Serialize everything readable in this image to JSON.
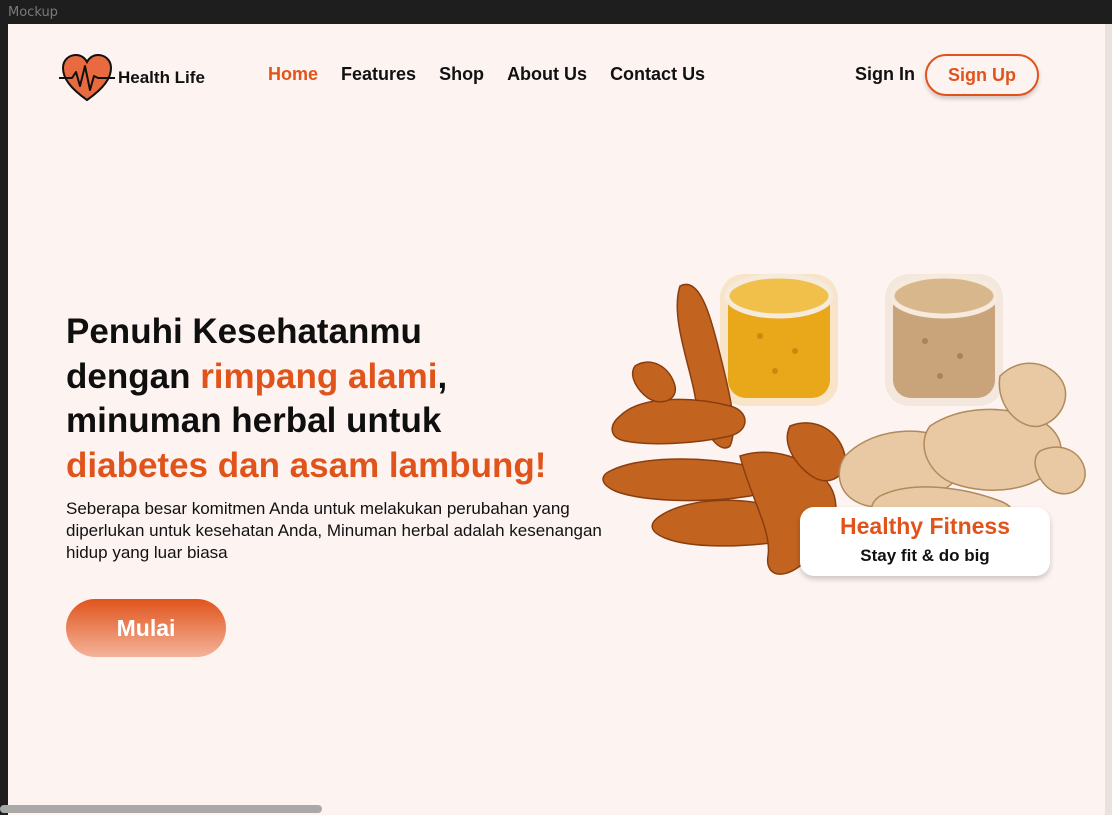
{
  "window": {
    "title": "Mockup"
  },
  "header": {
    "brand": "Health Life",
    "nav": [
      {
        "label": "Home",
        "active": true
      },
      {
        "label": "Features",
        "active": false
      },
      {
        "label": "Shop",
        "active": false
      },
      {
        "label": "About Us",
        "active": false
      },
      {
        "label": "Contact Us",
        "active": false
      }
    ],
    "sign_in": "Sign In",
    "sign_up": "Sign Up"
  },
  "hero": {
    "title_line1": "Penuhi Kesehatanmu",
    "title_line2_prefix": "dengan ",
    "title_line2_accent": "rimpang alami",
    "title_line2_suffix": ",",
    "title_line3": "minuman herbal untuk",
    "title_line4_accent": "diabetes dan asam lambung!",
    "description": "Seberapa besar komitmen Anda untuk melakukan perubahan yang diperlukan untuk kesehatan Anda, Minuman herbal adalah kesenangan hidup yang luar biasa",
    "cta": "Mulai"
  },
  "badge": {
    "title": "Healthy Fitness",
    "subtitle": "Stay fit & do big"
  },
  "colors": {
    "accent": "#e0541c",
    "background": "#fdf4f1",
    "text": "#111111"
  },
  "icons": [
    "heart-pulse-icon"
  ]
}
